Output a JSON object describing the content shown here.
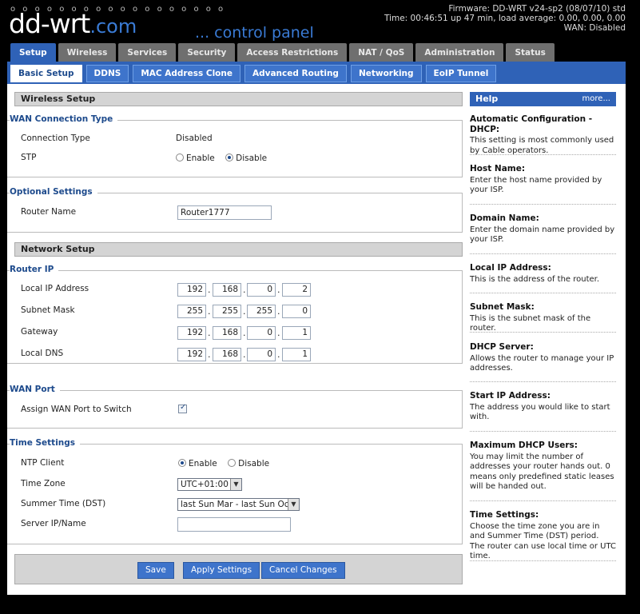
{
  "header": {
    "logo_text": "dd-wrt",
    "logo_dotcom": ".com",
    "logo_dots": "o o o o o o o o o o o o o o o o o o",
    "control_panel": "... control panel",
    "firmware": "Firmware: DD-WRT v24-sp2 (08/07/10) std",
    "time": "Time: 00:46:51 up 47 min, load average: 0.00, 0.00, 0.00",
    "wan": "WAN: Disabled"
  },
  "main_tabs": [
    "Setup",
    "Wireless",
    "Services",
    "Security",
    "Access Restrictions",
    "NAT / QoS",
    "Administration",
    "Status"
  ],
  "sub_tabs": [
    "Basic Setup",
    "DDNS",
    "MAC Address Clone",
    "Advanced Routing",
    "Networking",
    "EoIP Tunnel"
  ],
  "wireless_setup": {
    "title": "Wireless Setup",
    "wan_type": {
      "legend": "WAN Connection Type",
      "conn_label": "Connection Type",
      "conn_value": "Disabled",
      "stp_label": "STP",
      "enable": "Enable",
      "disable": "Disable"
    },
    "optional": {
      "legend": "Optional Settings",
      "router_name_label": "Router Name",
      "router_name_value": "Router1777"
    }
  },
  "network_setup": {
    "title": "Network Setup",
    "router_ip": {
      "legend": "Router IP",
      "rows": [
        {
          "label": "Local IP Address",
          "octets": [
            "192",
            "168",
            "0",
            "2"
          ]
        },
        {
          "label": "Subnet Mask",
          "octets": [
            "255",
            "255",
            "255",
            "0"
          ]
        },
        {
          "label": "Gateway",
          "octets": [
            "192",
            "168",
            "0",
            "1"
          ]
        },
        {
          "label": "Local DNS",
          "octets": [
            "192",
            "168",
            "0",
            "1"
          ]
        }
      ]
    },
    "wan_port": {
      "legend": "WAN Port",
      "assign_label": "Assign WAN Port to Switch"
    },
    "time": {
      "legend": "Time Settings",
      "ntp_label": "NTP Client",
      "enable": "Enable",
      "disable": "Disable",
      "tz_label": "Time Zone",
      "tz_value": "UTC+01:00",
      "dst_label": "Summer Time (DST)",
      "dst_value": "last Sun Mar - last Sun Oct",
      "server_label": "Server IP/Name",
      "server_value": ""
    }
  },
  "buttons": {
    "save": "Save",
    "apply": "Apply Settings",
    "cancel": "Cancel Changes"
  },
  "help": {
    "title": "Help",
    "more": "more...",
    "items": [
      {
        "title": "Automatic Configuration - DHCP:",
        "text": "This setting is most commonly used by Cable operators."
      },
      {
        "title": "Host Name:",
        "text": "Enter the host name provided by your ISP."
      },
      {
        "title": "Domain Name:",
        "text": "Enter the domain name provided by your ISP."
      },
      {
        "title": "Local IP Address:",
        "text": "This is the address of the router."
      },
      {
        "title": "Subnet Mask:",
        "text": "This is the subnet mask of the router."
      },
      {
        "title": "DHCP Server:",
        "text": "Allows the router to manage your IP addresses."
      },
      {
        "title": "Start IP Address:",
        "text": "The address you would like to start with."
      },
      {
        "title": "Maximum DHCP Users:",
        "text": "You may limit the number of addresses your router hands out. 0 means only predefined static leases will be handed out."
      },
      {
        "title": "Time Settings:",
        "text": "Choose the time zone you are in and Summer Time (DST) period. The router can use local time or UTC time."
      }
    ]
  }
}
